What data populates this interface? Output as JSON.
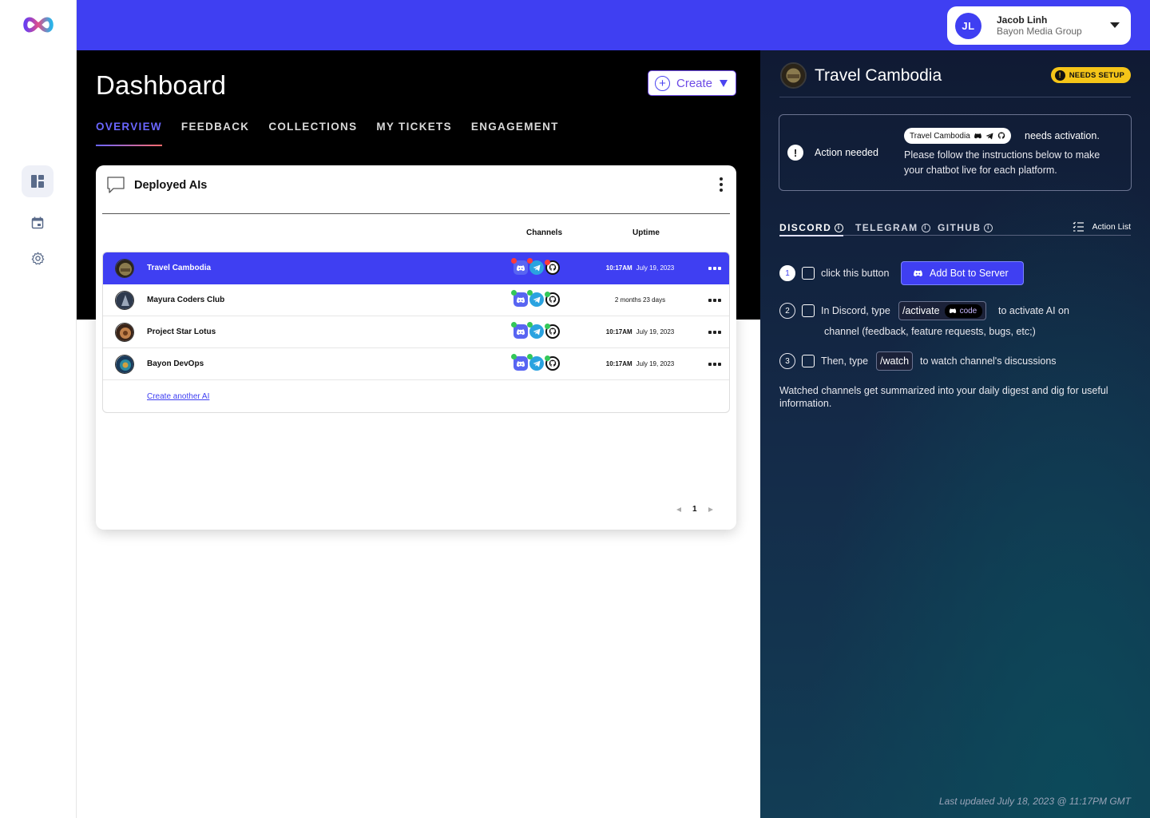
{
  "user": {
    "initials": "JL",
    "name": "Jacob Linh",
    "org": "Bayon Media Group"
  },
  "header": {
    "title": "Dashboard",
    "create_label": "Create"
  },
  "tabs": [
    {
      "label": "OVERVIEW"
    },
    {
      "label": "FEEDBACK"
    },
    {
      "label": "COLLECTIONS"
    },
    {
      "label": "MY TICKETS"
    },
    {
      "label": "ENGAGEMENT"
    }
  ],
  "card": {
    "title": "Deployed AIs",
    "col_channels": "Channels",
    "col_uptime": "Uptime",
    "rows": [
      {
        "name": "Travel Cambodia",
        "time": "10:17AM",
        "date": "July 19, 2023",
        "uptime": ""
      },
      {
        "name": "Mayura Coders Club",
        "time": "",
        "date": "",
        "uptime": "2 months 23 days"
      },
      {
        "name": "Project Star Lotus",
        "time": "10:17AM",
        "date": "July 19, 2023",
        "uptime": ""
      },
      {
        "name": "Bayon DevOps",
        "time": "10:17AM",
        "date": "July 19, 2023",
        "uptime": ""
      }
    ],
    "create_link": "Create another AI",
    "page": "1"
  },
  "panel": {
    "title": "Travel Cambodia",
    "badge": "NEEDS SETUP",
    "action_label": "Action needed",
    "chip_label": "Travel Cambodia",
    "needs_text": "needs activation.",
    "desc": "Please follow the instructions below to make your chatbot live for each platform.",
    "tabs": [
      {
        "label": "DISCORD"
      },
      {
        "label": "TELEGRAM"
      },
      {
        "label": "GITHUB"
      }
    ],
    "action_list": "Action List",
    "steps": {
      "s1_num": "1",
      "s1_text": "click this button",
      "add_bot": "Add Bot to Server",
      "s2_num": "2",
      "s2_pre": "In Discord, type",
      "s2_cmd": "/activate",
      "s2_code": "code",
      "s2_post": "to activate AI on",
      "s2_line2": "channel (feedback, feature requests, bugs, etc;)",
      "s3_num": "3",
      "s3_pre": "Then, type",
      "s3_cmd": "/watch",
      "s3_post": "to watch channel's discussions"
    },
    "watched_note": "Watched channels get summarized into your daily digest and dig for useful information.",
    "last_updated": "Last updated  July 18, 2023 @ 11:17PM GMT"
  },
  "colors": {
    "accent": "#3f3ff2",
    "badge": "#f5c518",
    "tab_active": "#6a66ff"
  },
  "icons": [
    "logo-icon",
    "dashboard-icon",
    "calendar-icon",
    "settings-icon",
    "chat-icon",
    "discord-icon",
    "telegram-icon",
    "github-icon"
  ]
}
